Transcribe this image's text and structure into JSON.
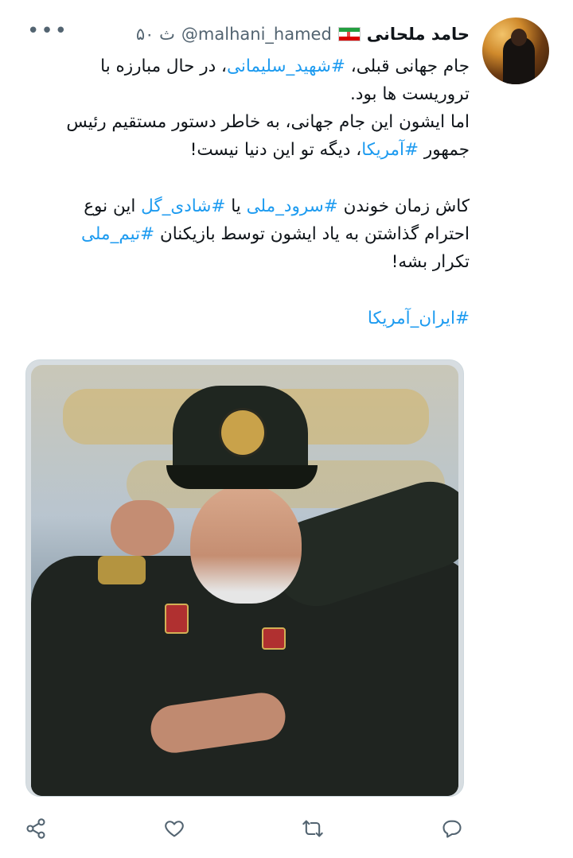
{
  "tweet": {
    "author_name": "حامد ملحانی",
    "handle": "@malhani_hamed",
    "time": "۵۰ ث",
    "more_label": "•••",
    "paragraphs": [
      [
        {
          "t": "جام جهانی قبلی، "
        },
        {
          "t": "#شهید_سلیمانی",
          "tag": true
        },
        {
          "t": "، در حال مبارزه با تروریست ها بود."
        }
      ],
      [
        {
          "t": "اما ایشون این جام جهانی، به خاطر دستور مستقیم رئیس جمهور "
        },
        {
          "t": "#آمریکا",
          "tag": true
        },
        {
          "t": "، دیگه تو این دنیا نیست!"
        }
      ],
      [
        {
          "t": "کاش زمان خوندن "
        },
        {
          "t": "#سرود_ملی",
          "tag": true
        },
        {
          "t": " یا "
        },
        {
          "t": "#شادی_گل",
          "tag": true
        },
        {
          "t": " این نوع احترام گذاشتن به یاد ایشون توسط بازیکنان "
        },
        {
          "t": "#تیم_ملی",
          "tag": true
        },
        {
          "t": " تکرار بشه!"
        }
      ],
      [
        {
          "t": "#ایران_آمریکا",
          "tag": true
        }
      ]
    ],
    "flag_icon": "iran-flag-icon",
    "accent_color": "#1d9bf0"
  },
  "actions": [
    {
      "name": "reply-icon"
    },
    {
      "name": "retweet-icon"
    },
    {
      "name": "like-icon"
    },
    {
      "name": "share-icon"
    }
  ]
}
